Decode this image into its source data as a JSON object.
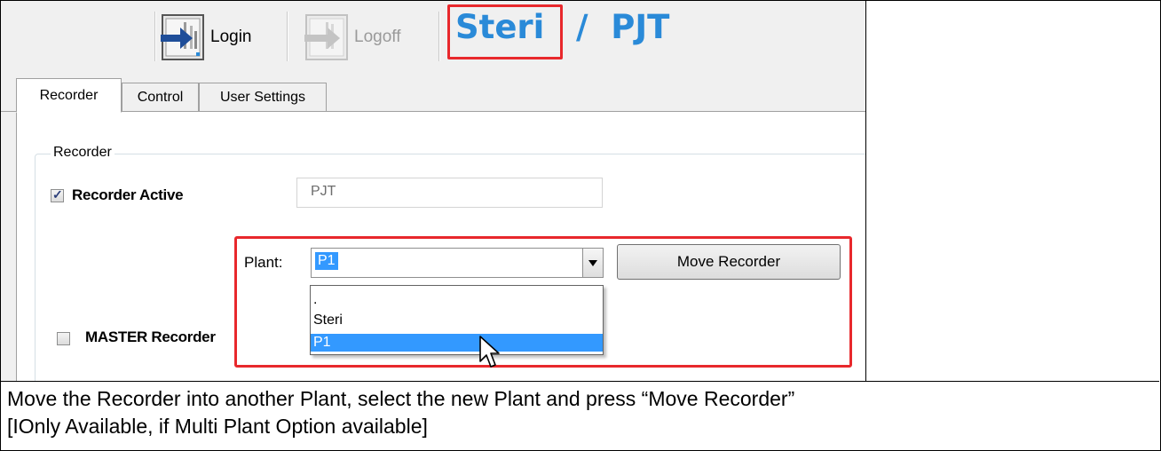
{
  "toolbar": {
    "login_label": "Login",
    "logoff_label": "Logoff",
    "plant_title": "Steri",
    "separator": "/",
    "recorder_title": "PJT"
  },
  "tabs": [
    {
      "label": "Recorder",
      "active": true
    },
    {
      "label": "Control",
      "active": false
    },
    {
      "label": "User Settings",
      "active": false
    }
  ],
  "recorder_group": {
    "title": "Recorder",
    "recorder_active_label": "Recorder Active",
    "recorder_active_checked": true,
    "recorder_name_value": "PJT",
    "plant_label": "Plant:",
    "plant_selected": "P1",
    "plant_options": [
      ".",
      "Steri",
      "P1"
    ],
    "move_button_label": "Move Recorder",
    "master_label": "MASTER Recorder",
    "master_checked": false
  },
  "caption": {
    "line1": "Move the Recorder into another Plant, select the new Plant and press “Move Recorder”",
    "line2": "[IOnly Available, if Multi Plant Option available]"
  },
  "colors": {
    "highlight_red": "#e8282c",
    "title_blue": "#2a8ad8",
    "selection_blue": "#3399ff"
  }
}
